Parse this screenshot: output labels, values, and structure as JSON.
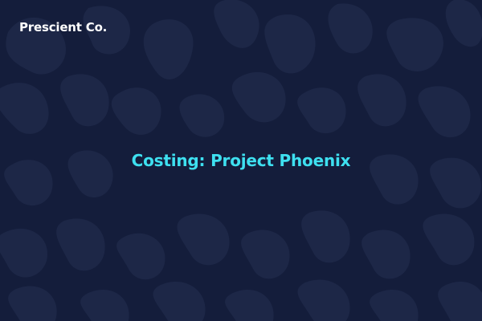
{
  "brand": {
    "name": "Prescient Co."
  },
  "slide": {
    "title": "Costing: Project Phoenix"
  },
  "colors": {
    "background": "#141d3b",
    "pattern": "#1d2747",
    "brand_text": "#ffffff",
    "title_text": "#3ee0f0"
  }
}
